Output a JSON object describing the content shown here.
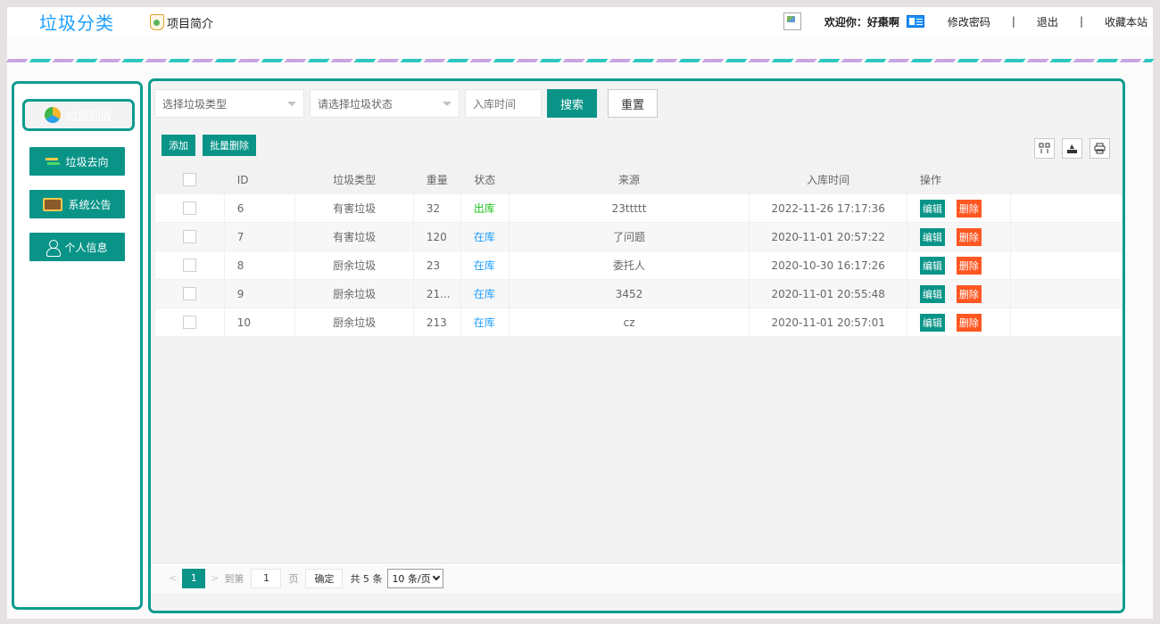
{
  "header": {
    "brand": "垃圾分类",
    "project_intro": "项目简介",
    "welcome": "欢迎你：好棗啊",
    "change_password": "修改密码",
    "separator": "|",
    "logout": "退出",
    "bookmark": "收藏本站"
  },
  "sidebar": {
    "items": [
      {
        "label": "垃圾回收",
        "icon": "recycle-icon"
      },
      {
        "label": "垃圾去向",
        "icon": "arrows-icon"
      },
      {
        "label": "系统公告",
        "icon": "bulletin-icon"
      },
      {
        "label": "个人信息",
        "icon": "person-icon"
      }
    ]
  },
  "filters": {
    "type_placeholder": "选择垃圾类型",
    "status_placeholder": "请选择垃圾状态",
    "time_placeholder": "入库时间",
    "search": "搜索",
    "reset": "重置"
  },
  "toolbar": {
    "add": "添加",
    "batch_delete": "批量删除",
    "tools": [
      "columns-icon",
      "export-icon",
      "print-icon"
    ]
  },
  "table": {
    "headers": [
      "ID",
      "垃圾类型",
      "重量",
      "状态",
      "来源",
      "入库时间",
      "操作"
    ],
    "edit_label": "编辑",
    "delete_label": "删除",
    "rows": [
      {
        "id": "6",
        "type": "有害垃圾",
        "weight": "32",
        "status": "出库",
        "source": "23ttttt",
        "time": "2022-11-26 17:17:36"
      },
      {
        "id": "7",
        "type": "有害垃圾",
        "weight": "120",
        "status": "在库",
        "source": "了问题",
        "time": "2020-11-01 20:57:22"
      },
      {
        "id": "8",
        "type": "厨余垃圾",
        "weight": "23",
        "status": "在库",
        "source": "委托人",
        "time": "2020-10-30 16:17:26"
      },
      {
        "id": "9",
        "type": "厨余垃圾",
        "weight": "21...",
        "status": "在库",
        "source": "3452",
        "time": "2020-11-01 20:55:48"
      },
      {
        "id": "10",
        "type": "厨余垃圾",
        "weight": "213",
        "status": "在库",
        "source": "cz",
        "time": "2020-11-01 20:57:01"
      }
    ]
  },
  "pager": {
    "prev": "<",
    "current": "1",
    "next": ">",
    "goto_label": "到第",
    "goto_value": "1",
    "page_unit": "页",
    "confirm": "确定",
    "total": "共 5 条",
    "limit": "10 条/页"
  },
  "colors": {
    "accent": "#0a9488",
    "brand": "#1e9fff",
    "danger": "#ff5722",
    "status_out": "#21c21f",
    "status_in": "#1e9fff"
  }
}
